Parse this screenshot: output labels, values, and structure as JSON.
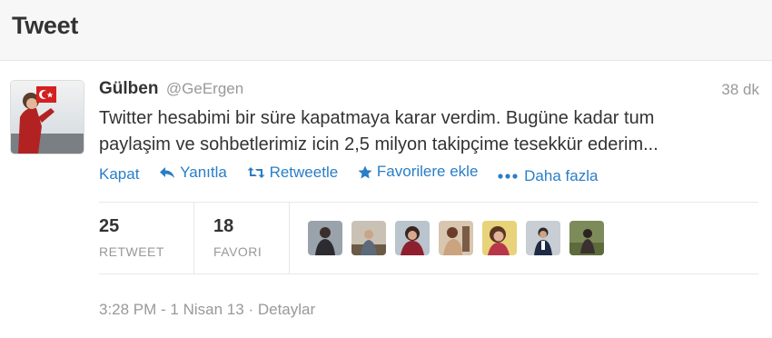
{
  "header": {
    "title": "Tweet"
  },
  "tweet": {
    "fullname": "Gülben",
    "username": "@GeErgen",
    "time": "38 dk",
    "text_line1": "Twitter hesabimi bir süre kapatmaya karar verdim. Bugüne kadar tum",
    "text_line2": "paylaşim ve sohbetlerimiz icin 2,5 milyon takipçime tesekkür ederim..."
  },
  "actions": {
    "close": "Kapat",
    "reply": "Yanıtla",
    "retweet": "Retweetle",
    "favorite": "Favorilere ekle",
    "more": "Daha fazla"
  },
  "stats": {
    "retweets": {
      "count": "25",
      "label": "RETWEET"
    },
    "favorites": {
      "count": "18",
      "label": "FAVORI"
    }
  },
  "footer": {
    "timestamp": "3:28 PM - 1 Nisan 13",
    "separator": "·",
    "details": "Detaylar"
  },
  "colors": {
    "link": "#2a7ec7",
    "muted": "#999999",
    "text": "#333333"
  }
}
